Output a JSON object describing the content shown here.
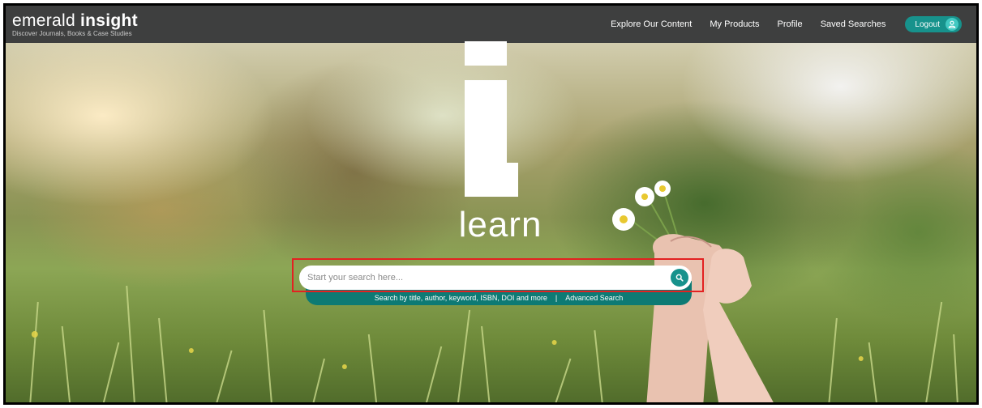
{
  "header": {
    "logo_light": "emerald",
    "logo_bold": "insight",
    "logo_tagline": "Discover Journals, Books & Case Studies",
    "nav": [
      {
        "label": "Explore Our Content"
      },
      {
        "label": "My Products"
      },
      {
        "label": "Profile"
      },
      {
        "label": "Saved Searches"
      }
    ],
    "logout_label": "Logout",
    "logout_icon": "user-icon"
  },
  "hero": {
    "headline": "learn"
  },
  "search": {
    "placeholder": "Start your search here...",
    "value": "",
    "button_icon": "search-icon",
    "hint_text": "Search by title, author, keyword, ISBN, DOI and more",
    "separator": "|",
    "advanced_label": "Advanced Search"
  },
  "colors": {
    "header_bg": "#3e3f3f",
    "accent_teal": "#17928c",
    "hint_bar": "#0d7a74",
    "highlight_red": "#e32121"
  }
}
